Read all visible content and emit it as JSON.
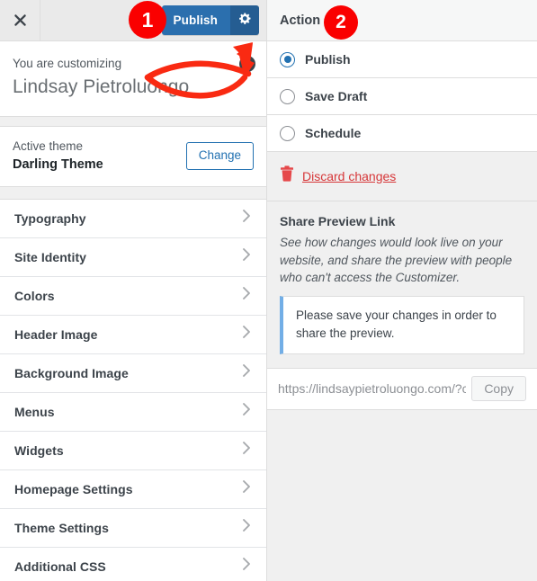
{
  "customizer": {
    "close_icon": "close-x-icon",
    "publish_label": "Publish",
    "gear_icon": "gear-icon",
    "help_icon": "help-question-icon",
    "customizing_label": "You are customizing",
    "site_title": "Lindsay Pietroluongo",
    "theme": {
      "active_label": "Active theme",
      "name": "Darling Theme",
      "change_label": "Change"
    },
    "nav_items": [
      {
        "label": "Typography",
        "chevron": "chevron-right-icon"
      },
      {
        "label": "Site Identity",
        "chevron": "chevron-right-icon"
      },
      {
        "label": "Colors",
        "chevron": "chevron-right-icon"
      },
      {
        "label": "Header Image",
        "chevron": "chevron-right-icon"
      },
      {
        "label": "Background Image",
        "chevron": "chevron-right-icon"
      },
      {
        "label": "Menus",
        "chevron": "chevron-right-icon"
      },
      {
        "label": "Widgets",
        "chevron": "chevron-right-icon"
      },
      {
        "label": "Homepage Settings",
        "chevron": "chevron-right-icon"
      },
      {
        "label": "Theme Settings",
        "chevron": "chevron-right-icon"
      },
      {
        "label": "Additional CSS",
        "chevron": "chevron-right-icon"
      }
    ]
  },
  "action_panel": {
    "header_title": "Action",
    "options": [
      {
        "label": "Publish",
        "selected": true
      },
      {
        "label": "Save Draft",
        "selected": false
      },
      {
        "label": "Schedule",
        "selected": false
      }
    ],
    "discard": {
      "icon": "trash-icon",
      "label": "Discard changes"
    },
    "share": {
      "title": "Share Preview Link",
      "description": "See how changes would look live on your website, and share the preview with people who can't access the Customizer.",
      "notice": "Please save your changes in order to share the preview.",
      "url_value": "https://lindsaypietroluongo.com/?c",
      "copy_label": "Copy"
    }
  },
  "annotations": {
    "badge_one": "1",
    "badge_two": "2",
    "arrow": "curved-red-arrow"
  },
  "colors": {
    "publish_blue": "#2b6fae",
    "gear_blue": "#255d92",
    "link_blue": "#2271b1",
    "annotation_red": "#fa0000",
    "discard_red": "#d63638",
    "panel_gray": "#f0f0f0",
    "notice_stripe": "#72aee6"
  }
}
